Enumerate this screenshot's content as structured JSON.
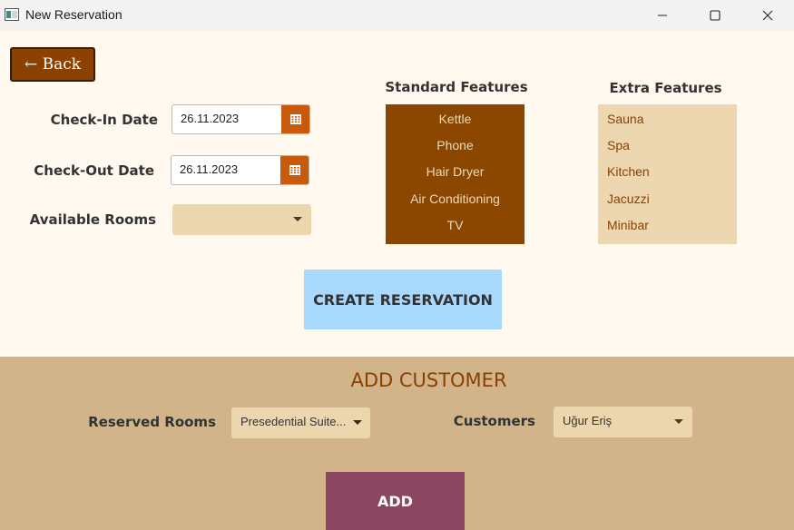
{
  "window": {
    "title": "New Reservation",
    "icon": "app-window-icon",
    "controls": [
      "minimize-icon",
      "maximize-icon",
      "close-icon"
    ]
  },
  "back_button": {
    "label": "← Back"
  },
  "form": {
    "checkin_label": "Check-In Date",
    "checkin_value": "26.11.2023",
    "checkout_label": "Check-Out Date",
    "checkout_value": "26.11.2023",
    "rooms_label": "Available Rooms",
    "rooms_value": ""
  },
  "standard_features": {
    "title": "Standard Features",
    "items": [
      "Kettle",
      "Phone",
      "Hair Dryer",
      "Air Conditioning",
      "TV"
    ]
  },
  "extra_features": {
    "title": "Extra Features",
    "items": [
      "Sauna",
      "Spa",
      "Kitchen",
      "Jacuzzi",
      "Minibar"
    ]
  },
  "create_button": {
    "label": "CREATE RESERVATION"
  },
  "add_customer": {
    "title": "ADD CUSTOMER",
    "reserved_rooms_label": "Reserved Rooms",
    "reserved_rooms_value": "Presedential Suite...",
    "customers_label": "Customers",
    "customers_value": "Uğur Eriş",
    "add_button": "ADD"
  },
  "colors": {
    "background": "#fff9ef",
    "brown": "#8b4600",
    "tan_panel": "#d2b48b",
    "combo": "#ecd6ad",
    "create_button": "#a8d8fb",
    "add_button": "#8b4660",
    "calendar_button": "#c75a0b"
  }
}
